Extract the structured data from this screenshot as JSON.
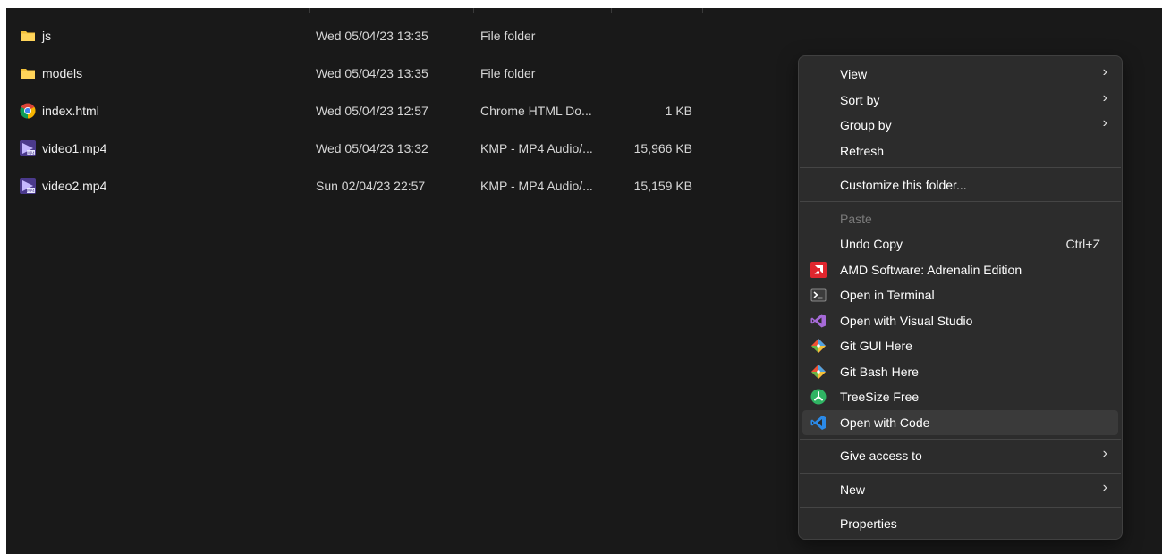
{
  "files": [
    {
      "icon": "folder-icon",
      "name": "js",
      "date": "Wed 05/04/23 13:35",
      "type": "File folder",
      "size": ""
    },
    {
      "icon": "folder-icon",
      "name": "models",
      "date": "Wed 05/04/23 13:35",
      "type": "File folder",
      "size": ""
    },
    {
      "icon": "chrome-icon",
      "name": "index.html",
      "date": "Wed 05/04/23 12:57",
      "type": "Chrome HTML Do...",
      "size": "1 KB"
    },
    {
      "icon": "kmp-video-icon",
      "name": "video1.mp4",
      "date": "Wed 05/04/23 13:32",
      "type": "KMP - MP4 Audio/...",
      "size": "15,966 KB"
    },
    {
      "icon": "kmp-video-icon",
      "name": "video2.mp4",
      "date": "Sun 02/04/23 22:57",
      "type": "KMP - MP4 Audio/...",
      "size": "15,159 KB"
    }
  ],
  "menu": {
    "items": [
      {
        "label": "View",
        "submenu": true
      },
      {
        "label": "Sort by",
        "submenu": true
      },
      {
        "label": "Group by",
        "submenu": true
      },
      {
        "label": "Refresh"
      },
      {
        "label": "Customize this folder..."
      },
      {
        "label": "Paste",
        "disabled": true
      },
      {
        "label": "Undo Copy",
        "shortcut": "Ctrl+Z"
      },
      {
        "label": "AMD Software: Adrenalin Edition",
        "icon": "amd-icon"
      },
      {
        "label": "Open in Terminal",
        "icon": "terminal-icon"
      },
      {
        "label": "Open with Visual Studio",
        "icon": "visual-studio-icon"
      },
      {
        "label": "Git GUI Here",
        "icon": "git-icon"
      },
      {
        "label": "Git Bash Here",
        "icon": "git-icon"
      },
      {
        "label": "TreeSize Free",
        "icon": "treesize-icon"
      },
      {
        "label": "Open with Code",
        "icon": "vscode-icon",
        "highlighted": true
      },
      {
        "label": "Give access to",
        "submenu": true
      },
      {
        "label": "New",
        "submenu": true
      },
      {
        "label": "Properties"
      }
    ],
    "chevron": "›"
  },
  "colors": {
    "background": "#191919",
    "menu_background": "#2c2c2c",
    "folder": "#f3c13a",
    "amd": "#e0262e",
    "visual_studio": "#a66ad8",
    "git": "#f05133",
    "treesize": "#2fb463",
    "vscode": "#2b8ae8"
  }
}
